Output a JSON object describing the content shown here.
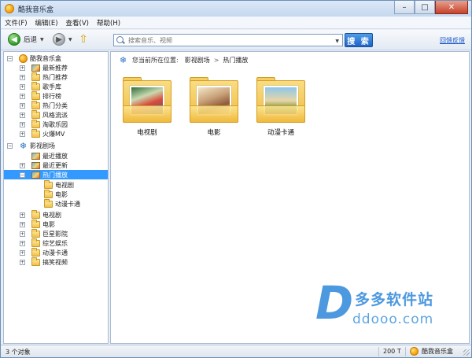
{
  "window": {
    "title": "酷我音乐盒"
  },
  "menu": [
    "文件(F)",
    "编辑(E)",
    "查看(V)",
    "帮助(H)"
  ],
  "toolbar": {
    "back_label": "后退",
    "search_placeholder": "搜索音乐、视频",
    "search_button": "搜 索",
    "feedback_link": "回馈反馈"
  },
  "tree": {
    "music_root": "酷我音乐盒",
    "music_items": [
      "最新推荐",
      "热门推荐",
      "歌手库",
      "排行榜",
      "热门分类",
      "风格流派",
      "淘歌乐园",
      "火爆MV"
    ],
    "video_root": "影视剧场",
    "recent_play": "最近播放",
    "recent_update": "最近更新",
    "hot_play": "热门播放",
    "hot_children": [
      "电视剧",
      "电影",
      "动漫卡通"
    ],
    "video_items": [
      "电视剧",
      "电影",
      "巨星影院",
      "综艺娱乐",
      "动漫卡通",
      "搞笑视频"
    ]
  },
  "breadcrumb": {
    "prefix": "您当前所在位置:",
    "level1": "影视剧场",
    "sep": ">",
    "level2": "热门播放"
  },
  "folders": [
    "电视剧",
    "电影",
    "动漫卡通"
  ],
  "watermark": {
    "letter": "D",
    "cn": "多多软件站",
    "url": "ddooo.com"
  },
  "status": {
    "count": "3 个对象",
    "size": "200 T",
    "app": "酷我音乐盒"
  }
}
